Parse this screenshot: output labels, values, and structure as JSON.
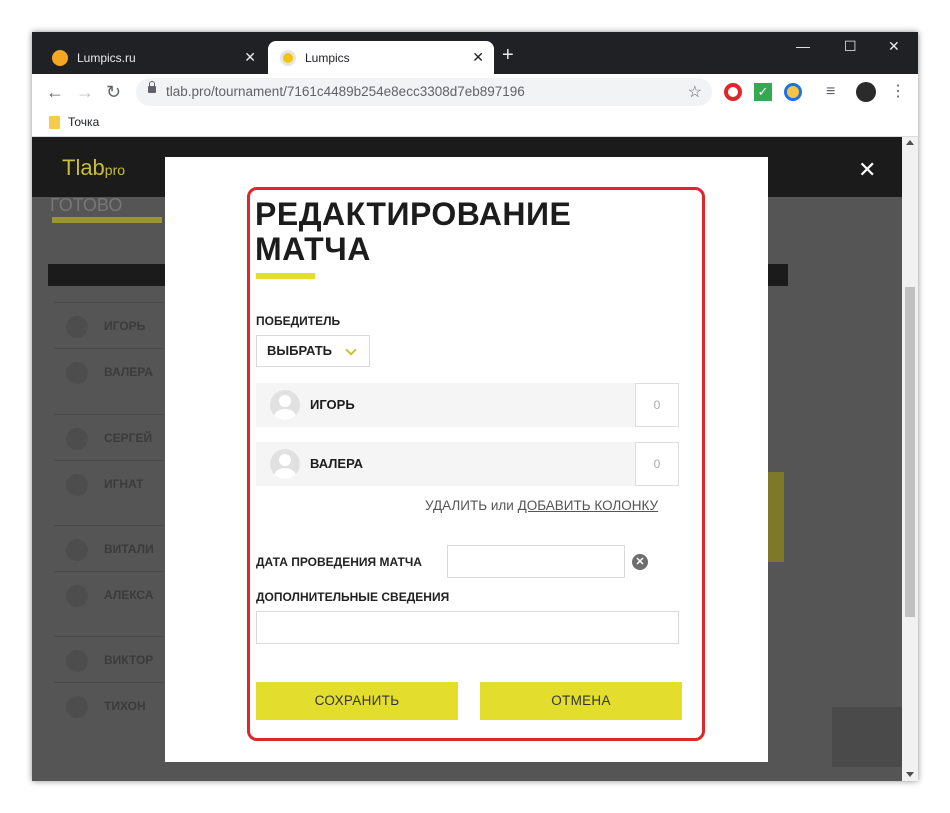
{
  "browser": {
    "tabs": [
      {
        "title": "Lumpics.ru",
        "active": false
      },
      {
        "title": "Lumpics",
        "active": true
      }
    ],
    "url": "tlab.pro/tournament/7161c4489b254e8ecc3308d7eb897196",
    "bookmark": "Точка"
  },
  "site": {
    "logo_main": "Tlab",
    "logo_suffix": "pro",
    "heading_partial": "ГОТОВО",
    "players": [
      "ИГОРЬ",
      "ВАЛЕРА",
      "СЕРГЕЙ",
      "ИГНАТ",
      "ВИТАЛИ",
      "АЛЕКСА",
      "ВИКТОР",
      "ТИХОН"
    ]
  },
  "modal": {
    "title": "РЕДАКТИРОВАНИЕ МАТЧА",
    "winner_label": "ПОБЕДИТЕЛЬ",
    "winner_select": "ВЫБРАТЬ",
    "participants": [
      {
        "name": "ИГОРЬ",
        "score": "0"
      },
      {
        "name": "ВАЛЕРА",
        "score": "0"
      }
    ],
    "delete_column": "УДАЛИТЬ",
    "or_text": "или",
    "add_column": "ДОБАВИТЬ КОЛОНКУ",
    "date_label": "ДАТА ПРОВЕДЕНИЯ МАТЧА",
    "extra_label": "ДОПОЛНИТЕЛЬНЫЕ СВЕДЕНИЯ",
    "save_button": "СОХРАНИТЬ",
    "cancel_button": "ОТМЕНА"
  },
  "colors": {
    "accent": "#e3dd2e",
    "highlight": "#e0262a"
  }
}
